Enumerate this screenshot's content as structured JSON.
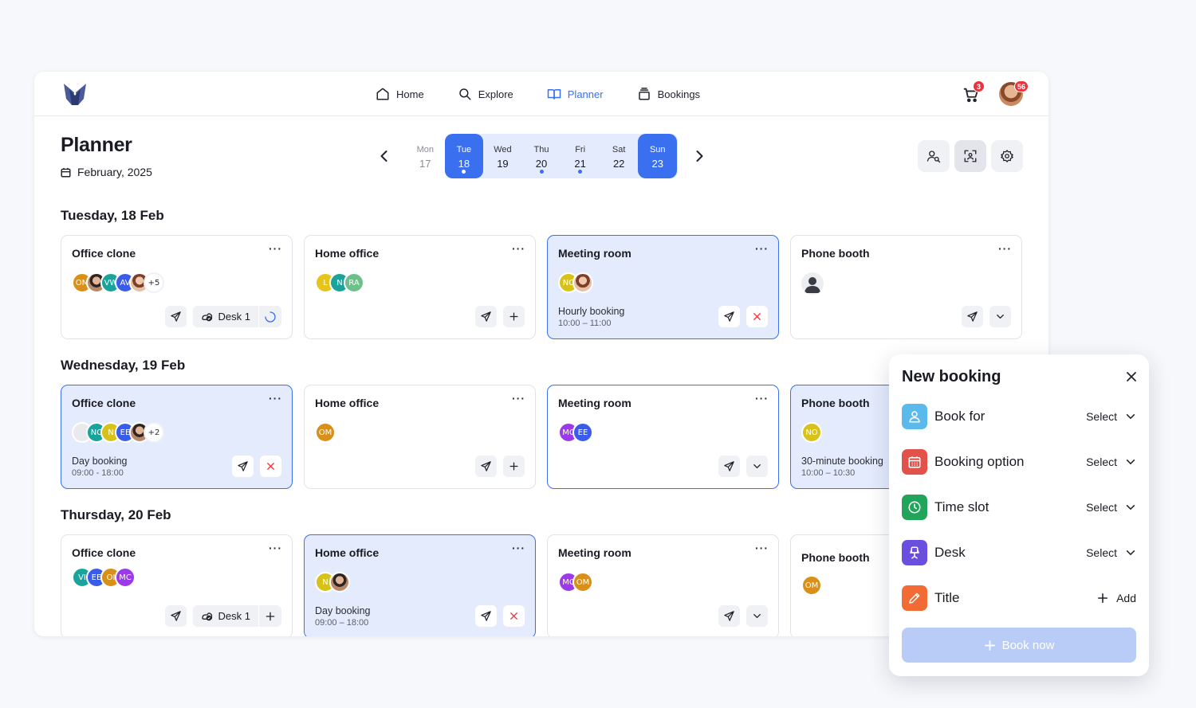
{
  "nav": [
    {
      "label": "Home",
      "icon": "home-icon"
    },
    {
      "label": "Explore",
      "icon": "search-icon"
    },
    {
      "label": "Planner",
      "icon": "book-icon"
    },
    {
      "label": "Bookings",
      "icon": "stack-icon"
    }
  ],
  "header": {
    "cart_count": "3",
    "notif_count": "56"
  },
  "page": {
    "title": "Planner",
    "month": "February, 2025"
  },
  "week": [
    {
      "name": "Mon",
      "num": "17"
    },
    {
      "name": "Tue",
      "num": "18"
    },
    {
      "name": "Wed",
      "num": "19"
    },
    {
      "name": "Thu",
      "num": "20"
    },
    {
      "name": "Fri",
      "num": "21"
    },
    {
      "name": "Sat",
      "num": "22"
    },
    {
      "name": "Sun",
      "num": "23"
    }
  ],
  "sections": [
    {
      "title": "Tuesday, 18 Feb",
      "cards": [
        {
          "title": "Office clone",
          "avatars": [
            "OM",
            "",
            "VW",
            "AV",
            "",
            "+5"
          ],
          "desk": "Desk 1"
        },
        {
          "title": "Home office",
          "avatars": [
            "L",
            "N",
            "RA"
          ]
        },
        {
          "title": "Meeting room",
          "avatars": [
            "NC",
            ""
          ],
          "booking": "Hourly booking",
          "time": "10:00 – 11:00"
        },
        {
          "title": "Phone booth"
        }
      ]
    },
    {
      "title": "Wednesday, 19 Feb",
      "cards": [
        {
          "title": "Office clone",
          "avatars": [
            "",
            "NC",
            "N",
            "EE",
            "",
            "+2"
          ],
          "booking": "Day booking",
          "time": "09:00 - 18:00"
        },
        {
          "title": "Home office",
          "avatars": [
            "OM"
          ]
        },
        {
          "title": "Meeting room",
          "avatars": [
            "MC",
            "EE"
          ]
        },
        {
          "title": "Phone booth",
          "avatars": [
            "NO"
          ],
          "booking": "30-minute booking",
          "time": "10:00 – 10:30"
        }
      ]
    },
    {
      "title": "Thursday, 20 Feb",
      "cards": [
        {
          "title": "Office clone",
          "avatars": [
            "VI",
            "EE",
            "OI",
            "MC"
          ],
          "desk": "Desk 1"
        },
        {
          "title": "Home office",
          "avatars": [
            "N",
            ""
          ],
          "booking": "Day booking",
          "time": "09:00 – 18:00"
        },
        {
          "title": "Meeting room",
          "avatars": [
            "MC",
            "OM"
          ]
        },
        {
          "title": "Phone booth",
          "avatars": [
            "OM"
          ]
        }
      ]
    }
  ],
  "new_booking": {
    "title": "New booking",
    "rows": [
      {
        "label": "Book for",
        "action": "Select"
      },
      {
        "label": "Booking option",
        "action": "Select"
      },
      {
        "label": "Time slot",
        "action": "Select"
      },
      {
        "label": "Desk",
        "action": "Select"
      },
      {
        "label": "Title",
        "action": "Add"
      }
    ],
    "button": "Book now"
  },
  "colors": {
    "accent": "#3a6ff0",
    "danger": "#e9333d"
  }
}
